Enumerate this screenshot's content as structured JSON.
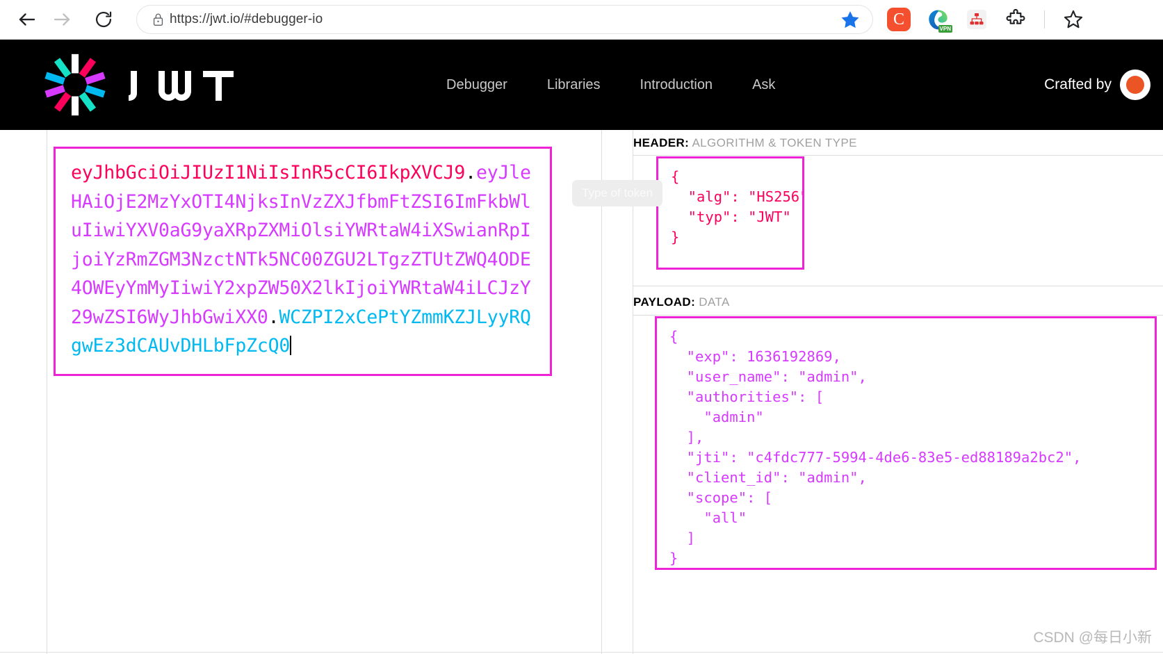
{
  "browser": {
    "back_label": "Back",
    "forward_label": "Forward",
    "reload_label": "Reload",
    "url": "https://jwt.io/#debugger-io",
    "lock_icon": "lock-icon",
    "star_icon": "bookmark-star-icon",
    "extensions": [
      {
        "name": "clipboard-extension",
        "glyph": "C"
      },
      {
        "name": "edge-vpn-extension",
        "badge": "VPN"
      },
      {
        "name": "sitemap-extension",
        "glyph": ""
      },
      {
        "name": "puzzle-extensions",
        "glyph": ""
      }
    ]
  },
  "site": {
    "brand": "JWT",
    "nav": [
      {
        "label": "Debugger"
      },
      {
        "label": "Libraries"
      },
      {
        "label": "Introduction"
      },
      {
        "label": "Ask"
      }
    ],
    "crafted_by": "Crafted by"
  },
  "debugger": {
    "encoded": {
      "header_part": "eyJhbGciOiJIUzI1NiIsInR5cCI6IkpXVCJ9",
      "dot1": ".",
      "payload_part": "eyJleHAiOjE2MzYxOTI4NjksInVzZXJfbmFtZSI6ImFkbWluIiwiYXV0aG9yaXRpZXMiOlsiYWRtaW4iXSwianRpIjoiYzRmZGM3NzctNTk5NC00ZGU2LTgzZTUtZWQ4ODE4OWEyYmMyIiwiY2xpZW50X2lkIjoiYWRtaW4iLCJzY29wZSI6WyJhbGwiXX0",
      "dot2": ".",
      "signature_part": "WCZPI2xCePtYZmmKZJLyyRQgwEz3dCAUvDHLbFpZcQ0"
    },
    "tooltip": "Type of token",
    "header_panel": {
      "label_key": "HEADER:",
      "label_desc": "ALGORITHM & TOKEN TYPE",
      "json": "{\n  \"alg\": \"HS256\",\n  \"typ\": \"JWT\"\n}"
    },
    "payload_panel": {
      "label_key": "PAYLOAD:",
      "label_desc": "DATA",
      "json": "{\n  \"exp\": 1636192869,\n  \"user_name\": \"admin\",\n  \"authorities\": [\n    \"admin\"\n  ],\n  \"jti\": \"c4fdc777-5994-4de6-83e5-ed88189a2bc2\",\n  \"client_id\": \"admin\",\n  \"scope\": [\n    \"all\"\n  ]\n}"
    },
    "colors": {
      "header_color": "#fb015b",
      "payload_color": "#d63aff",
      "signature_color": "#00b9f1",
      "annotation_box": "#ef23d6"
    }
  },
  "watermark": "CSDN @每日小新"
}
